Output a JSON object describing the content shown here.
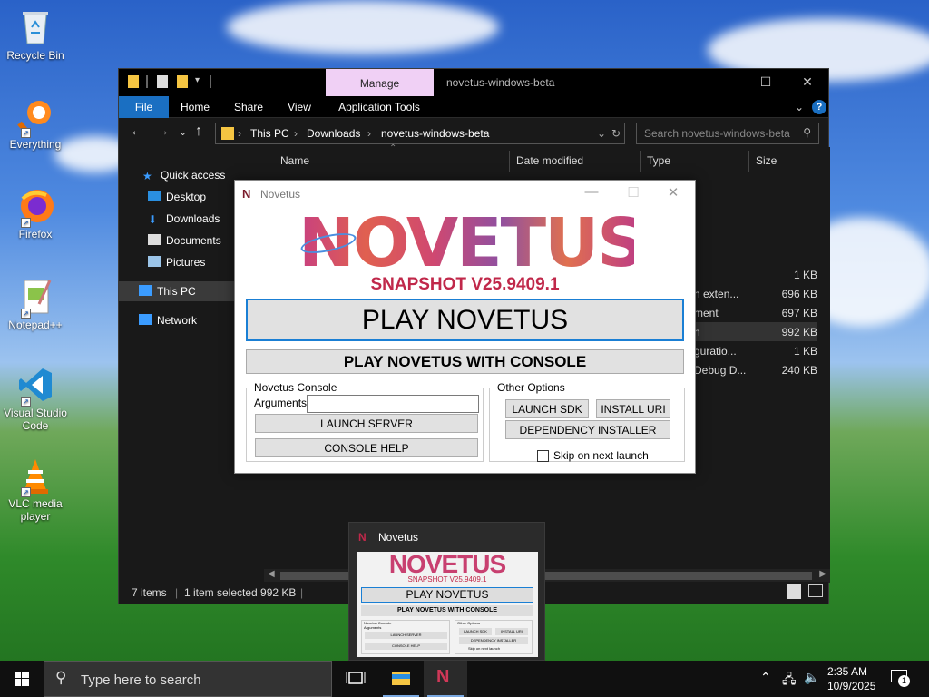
{
  "desktop": {
    "icons": [
      {
        "label": "Recycle Bin"
      },
      {
        "label": "Everything"
      },
      {
        "label": "Firefox"
      },
      {
        "label": "Notepad++"
      },
      {
        "label": "Visual Studio Code"
      },
      {
        "label": "VLC media player"
      }
    ]
  },
  "explorer": {
    "manage_tab": "Manage",
    "window_title": "novetus-windows-beta",
    "ribbon_tabs": [
      "File",
      "Home",
      "Share",
      "View",
      "Application Tools"
    ],
    "breadcrumb": [
      "This PC",
      "Downloads",
      "novetus-windows-beta"
    ],
    "search_placeholder": "Search novetus-windows-beta",
    "nav": {
      "quick_access": "Quick access",
      "desktop": "Desktop",
      "downloads": "Downloads",
      "documents": "Documents",
      "pictures": "Pictures",
      "this_pc": "This PC",
      "network": "Network"
    },
    "columns": {
      "name": "Name",
      "date": "Date modified",
      "type": "Type",
      "size": "Size"
    },
    "files": [
      {
        "type": "",
        "size": "1 KB"
      },
      {
        "type": "n exten...",
        "size": "696 KB"
      },
      {
        "type": "ment",
        "size": "697 KB"
      },
      {
        "type": "n",
        "size": "992 KB"
      },
      {
        "type": "guratio...",
        "size": "1 KB"
      },
      {
        "type": "Debug D...",
        "size": "240 KB"
      }
    ],
    "status": {
      "items": "7 items",
      "selected": "1 item selected  992 KB"
    }
  },
  "novetus": {
    "title": "Novetus",
    "logo_letter": "N",
    "logo_text": "NOVETUS",
    "snapshot": "SNAPSHOT V25.9409.1",
    "play": "PLAY NOVETUS",
    "play_console": "PLAY NOVETUS WITH CONSOLE",
    "console_group": "Novetus Console",
    "arguments_label": "Arguments:",
    "arguments_value": "",
    "launch_server": "LAUNCH SERVER",
    "console_help": "CONSOLE HELP",
    "other_group": "Other Options",
    "launch_sdk": "LAUNCH SDK",
    "install_uri": "INSTALL URI",
    "dependency_installer": "DEPENDENCY INSTALLER",
    "skip_label": "Skip on next launch"
  },
  "thumbnail": {
    "title": "Novetus",
    "logo": "NOVETUS",
    "snapshot": "SNAPSHOT V25.9409.1",
    "play": "PLAY NOVETUS",
    "play_console": "PLAY NOVETUS WITH CONSOLE",
    "console_group": "Novetus Console",
    "arguments_label": "Arguments",
    "launch_server": "LAUNCH SERVER",
    "console_help": "CONSOLE HELP",
    "other_group": "Other Options",
    "launch_sdk": "LAUNCH SDK",
    "install_uri": "INSTALL URI",
    "dependency_installer": "DEPENDENCY INSTALLER",
    "skip_label": "Skip on next launch"
  },
  "taskbar": {
    "search_placeholder": "Type here to search",
    "time": "2:35 AM",
    "date": "10/9/2025",
    "notification_count": "1"
  },
  "colors": {
    "accent": "#1a6fc2",
    "manage_tab": "#f0d0f5",
    "snapshot": "#c0284a"
  }
}
